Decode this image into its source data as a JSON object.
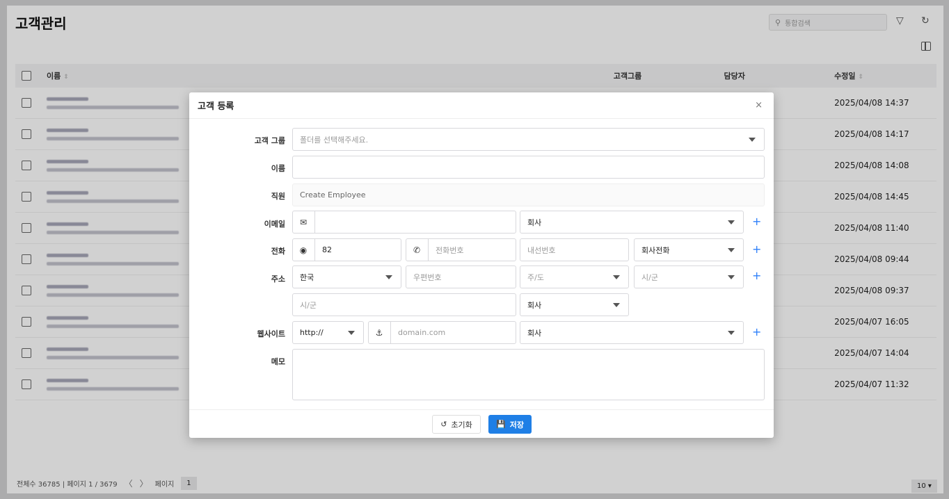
{
  "page": {
    "title": "고객관리",
    "search_placeholder": "통합검색",
    "icons": {
      "search": "search-icon",
      "filter": "filter-icon",
      "refresh": "refresh-icon",
      "columns": "columns-icon"
    }
  },
  "table": {
    "headers": {
      "name": "이름",
      "group": "고객그룹",
      "owner": "담당자",
      "modified": "수정일"
    },
    "rows": [
      {
        "modified": "2025/04/08 14:37"
      },
      {
        "modified": "2025/04/08 14:17"
      },
      {
        "modified": "2025/04/08 14:08"
      },
      {
        "modified": "2025/04/08 14:45"
      },
      {
        "modified": "2025/04/08 11:40"
      },
      {
        "modified": "2025/04/08 09:44"
      },
      {
        "modified": "2025/04/08 09:37"
      },
      {
        "modified": "2025/04/07 16:05"
      },
      {
        "modified": "2025/04/07 14:04"
      },
      {
        "modified": "2025/04/07 11:32"
      }
    ]
  },
  "footer": {
    "summary": "전체수 36785 | 페이지 1 / 3679",
    "prev": "〈",
    "next": "〉",
    "page_label": "페이지",
    "current_page": "1",
    "page_size": "10 ▾"
  },
  "modal": {
    "title": "고객 등록",
    "close": "×",
    "labels": {
      "group": "고객 그룹",
      "name": "이름",
      "employee": "직원",
      "email": "이메일",
      "phone": "전화",
      "address": "주소",
      "website": "웹사이트",
      "memo": "메모"
    },
    "group_placeholder": "폴더를 선택해주세요.",
    "employee_value": "Create Employee",
    "email_type": "회사",
    "phone_country": "82",
    "phone_placeholder": "전화번호",
    "ext_placeholder": "내선번호",
    "phone_type": "회사전화",
    "address_country": "한국",
    "zip_placeholder": "우편번호",
    "state_placeholder": "주/도",
    "city_placeholder": "시/군",
    "city2_placeholder": "시/군",
    "address_type": "회사",
    "website_protocol": "http://",
    "website_placeholder": "domain.com",
    "website_type": "회사",
    "plus": "+",
    "reset_label": "초기화",
    "save_label": "저장"
  }
}
